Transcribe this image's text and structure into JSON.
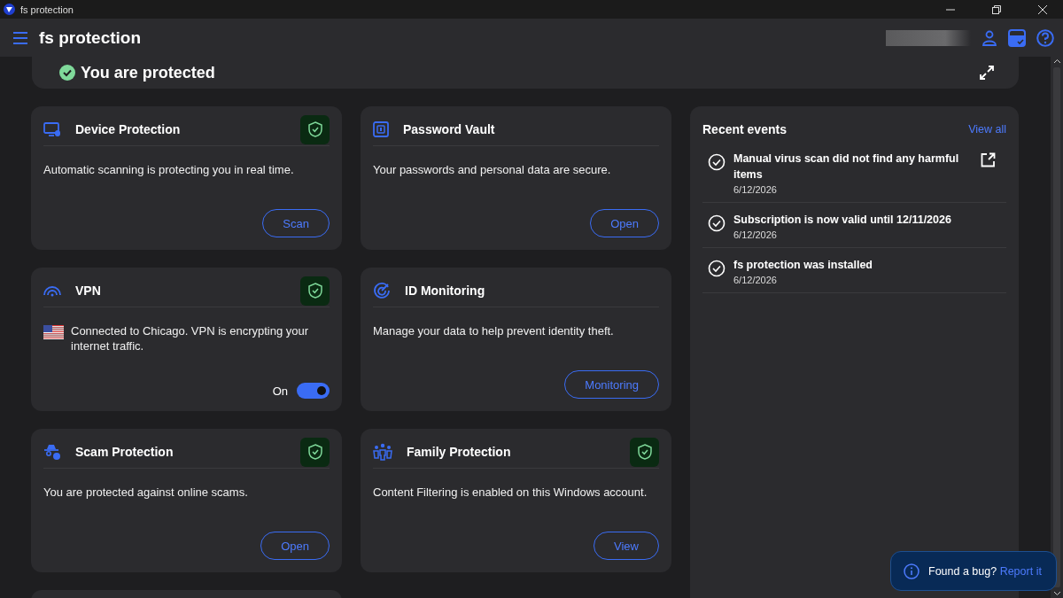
{
  "window": {
    "title": "fs protection"
  },
  "header": {
    "title": "fs protection"
  },
  "status": {
    "text": "You are protected",
    "protected": true
  },
  "cards": [
    {
      "title": "Device Protection",
      "description": "Automatic scanning is protecting you in real time.",
      "flag": false,
      "shield": true,
      "action": {
        "kind": "button",
        "label": "Scan"
      }
    },
    {
      "title": "Password Vault",
      "description": "Your passwords and personal data are secure.",
      "flag": false,
      "shield": false,
      "action": {
        "kind": "button",
        "label": "Open"
      }
    },
    {
      "title": "VPN",
      "description": "Connected to Chicago. VPN is encrypting your internet traffic.",
      "flag": true,
      "shield": true,
      "action": {
        "kind": "toggle",
        "label": "On",
        "on": true
      }
    },
    {
      "title": "ID Monitoring",
      "description": "Manage your data to help prevent identity theft.",
      "flag": false,
      "shield": false,
      "action": {
        "kind": "button",
        "label": "Monitoring"
      }
    },
    {
      "title": "Scam Protection",
      "description": "You are protected against online scams.",
      "flag": false,
      "shield": true,
      "action": {
        "kind": "button",
        "label": "Open"
      }
    },
    {
      "title": "Family Protection",
      "description": "Content Filtering is enabled on this Windows account.",
      "flag": false,
      "shield": true,
      "action": {
        "kind": "button",
        "label": "View"
      }
    }
  ],
  "recent_events": {
    "title": "Recent events",
    "view_all": "View all",
    "events": [
      {
        "text": "Manual virus scan did not find any harmful items",
        "date": "6/12/2026",
        "has_link": true
      },
      {
        "text": "Subscription is now valid until 12/11/2026",
        "date": "6/12/2026",
        "has_link": false
      },
      {
        "text": "fs protection was installed",
        "date": "6/12/2026",
        "has_link": false
      }
    ]
  },
  "toast": {
    "text": "Found a bug?",
    "link": "Report it"
  }
}
